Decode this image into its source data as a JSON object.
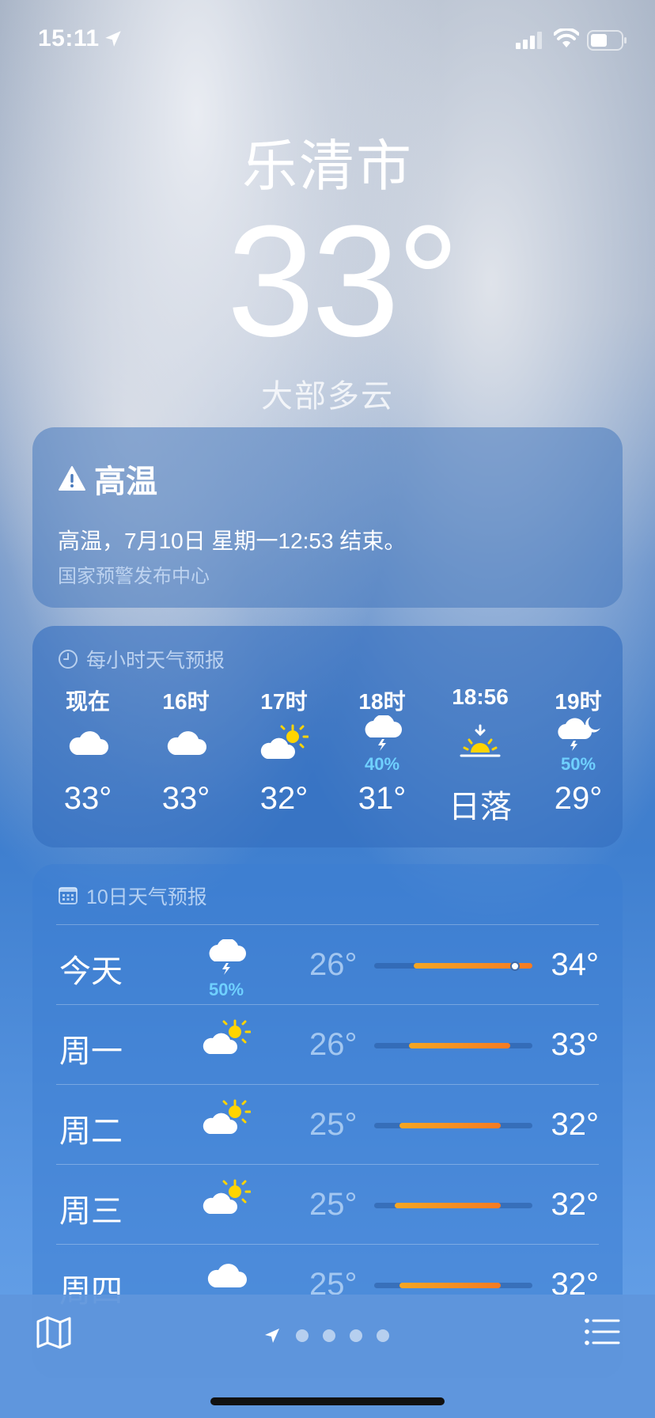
{
  "status": {
    "time": "15:11"
  },
  "header": {
    "city": "乐清市",
    "temp": "33°",
    "condition": "大部多云"
  },
  "alert": {
    "title": "高温",
    "text": "高温，7月10日 星期一12:53 结束。",
    "source": "国家预警发布中心"
  },
  "hourly": {
    "title": "每小时天气预报",
    "items": [
      {
        "time": "现在",
        "icon": "cloud-icon",
        "pct": "",
        "value": "33°"
      },
      {
        "time": "16时",
        "icon": "cloud-icon",
        "pct": "",
        "value": "33°"
      },
      {
        "time": "17时",
        "icon": "partly-sunny-icon",
        "pct": "",
        "value": "32°"
      },
      {
        "time": "18时",
        "icon": "thunderstorm-icon",
        "pct": "40%",
        "value": "31°"
      },
      {
        "time": "18:56",
        "icon": "sunset-icon",
        "pct": "",
        "value": "日落"
      },
      {
        "time": "19时",
        "icon": "thunderstorm-night-icon",
        "pct": "50%",
        "value": "29°"
      }
    ]
  },
  "daily": {
    "title": "10日天气预报",
    "items": [
      {
        "day": "今天",
        "icon": "thunderstorm-icon",
        "pct": "50%",
        "low": "26°",
        "high": "34°",
        "range_start": 0.25,
        "range_end": 1.0,
        "current": 0.89
      },
      {
        "day": "周一",
        "icon": "partly-sunny-icon",
        "pct": "",
        "low": "26°",
        "high": "33°",
        "range_start": 0.22,
        "range_end": 0.86
      },
      {
        "day": "周二",
        "icon": "partly-sunny-icon",
        "pct": "",
        "low": "25°",
        "high": "32°",
        "range_start": 0.16,
        "range_end": 0.8
      },
      {
        "day": "周三",
        "icon": "partly-sunny-icon",
        "pct": "",
        "low": "25°",
        "high": "32°",
        "range_start": 0.13,
        "range_end": 0.8
      },
      {
        "day": "周四",
        "icon": "cloud-icon",
        "pct": "",
        "low": "25°",
        "high": "32°",
        "range_start": 0.16,
        "range_end": 0.8
      }
    ]
  },
  "colors": {
    "precip": "#6fd0ff",
    "accent_warm": "#f5a623",
    "accent_hot": "#f57b23"
  }
}
